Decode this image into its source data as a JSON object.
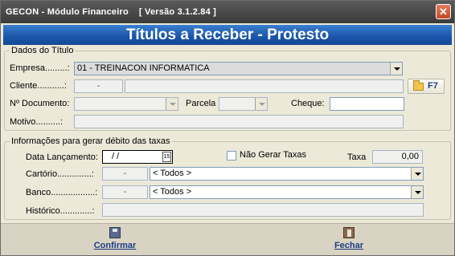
{
  "window": {
    "title": "GECON - Módulo Financeiro    [ Versão 3.1.2.84 ]",
    "close": "✕"
  },
  "banner": {
    "title": "Títulos a Receber - Protesto"
  },
  "dados": {
    "legend": "Dados do Título",
    "empresa_label": "Empresa.........:",
    "empresa_value": "01 - TREINACON INFORMATICA",
    "cliente_label": "Cliente...........:",
    "cliente_code": "-",
    "cliente_name": "",
    "f7_label": "F7",
    "documento_label": "Nº Documento:",
    "documento_value": "",
    "parcela_label": "Parcela",
    "parcela_value": "",
    "cheque_label": "Cheque:",
    "cheque_value": "",
    "motivo_label": "Motivo..........:",
    "motivo_value": ""
  },
  "taxas": {
    "legend": "Informações para gerar débito das taxas",
    "data_label": "Data Lançamento:",
    "data_value": "/  /",
    "cal_day": "15",
    "nao_gerar_label": "Não Gerar Taxas",
    "nao_gerar_checked": false,
    "taxa_label": "Taxa",
    "taxa_value": "0,00",
    "cartorio_label": "Cartório..............:",
    "cartorio_code": "-",
    "cartorio_value": "< Todos >",
    "banco_label": "Banco..................:",
    "banco_code": "-",
    "banco_value": "< Todos >",
    "historico_label": "Histórico.............:",
    "historico_value": ""
  },
  "actions": {
    "confirmar": "Confirmar",
    "fechar": "Fechar"
  },
  "colors": {
    "banner": "#1a55a8",
    "titlebar": "#3a3a3a",
    "link": "#1b3d88"
  }
}
